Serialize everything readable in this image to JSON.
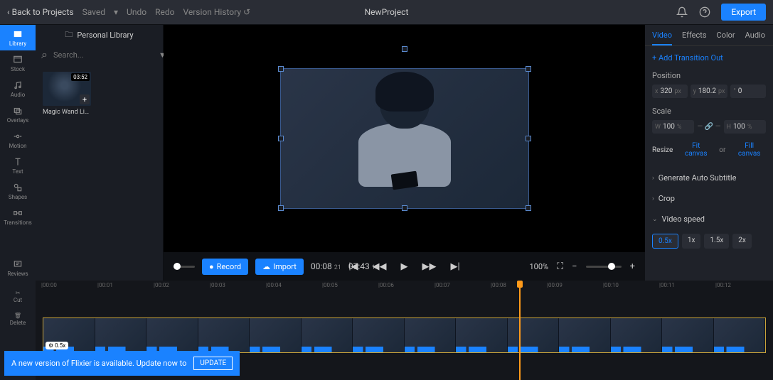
{
  "topbar": {
    "back": "Back to Projects",
    "saved": "Saved",
    "undo": "Undo",
    "redo": "Redo",
    "version_history": "Version History",
    "title": "NewProject",
    "export": "Export"
  },
  "leftnav": [
    {
      "label": "Library"
    },
    {
      "label": "Stock"
    },
    {
      "label": "Audio"
    },
    {
      "label": "Overlays"
    },
    {
      "label": "Motion"
    },
    {
      "label": "Text"
    },
    {
      "label": "Shapes"
    },
    {
      "label": "Transitions"
    },
    {
      "label": "Reviews"
    }
  ],
  "library": {
    "header": "Personal Library",
    "search_placeholder": "Search...",
    "clip": {
      "duration": "03:52",
      "name": "Magic Wand Light..."
    }
  },
  "controls": {
    "record": "Record",
    "import": "Import",
    "current": "00:08",
    "current_frames": "21",
    "total": "07:43",
    "total_frames": "14",
    "zoom": "100%"
  },
  "rightpanel": {
    "tabs": [
      "Video",
      "Effects",
      "Color",
      "Audio"
    ],
    "add_transition_out": "Add Transition Out",
    "position_label": "Position",
    "pos_x": "320",
    "pos_x_unit": "px",
    "pos_y": "180.2",
    "pos_y_unit": "px",
    "rot_deg": "°",
    "rot_val": "0",
    "scale_label": "Scale",
    "scale_w": "100",
    "scale_w_unit": "%",
    "scale_h": "100",
    "scale_h_unit": "%",
    "resize": "Resize",
    "fit": "Fit canvas",
    "or": "or",
    "fill": "Fill canvas",
    "auto_sub": "Generate Auto Subtitle",
    "crop": "Crop",
    "video_speed": "Video speed",
    "speeds": [
      "0.5x",
      "1x",
      "1.5x",
      "2x"
    ]
  },
  "timeline": {
    "tools": [
      {
        "label": "Cut"
      },
      {
        "label": "Delete"
      }
    ],
    "ticks": [
      "|00:00",
      "|00:01",
      "|00:02",
      "|00:03",
      "|00:04",
      "|00:05",
      "|00:06",
      "|00:07",
      "|00:08",
      "|00:09",
      "|00:10",
      "|00:11",
      "|00:12"
    ],
    "speed_badge": "0.5x"
  },
  "notification": {
    "text": "A new version of Flixier is available. Update now to",
    "button": "UPDATE"
  }
}
